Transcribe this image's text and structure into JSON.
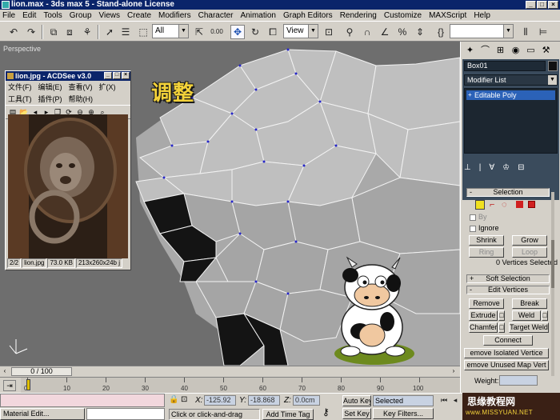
{
  "window": {
    "title": "lion.max - 3ds max 5 - Stand-alone License"
  },
  "menu": [
    "File",
    "Edit",
    "Tools",
    "Group",
    "Views",
    "Create",
    "Modifiers",
    "Character",
    "Animation",
    "Graph Editors",
    "Rendering",
    "Customize",
    "MAXScript",
    "Help"
  ],
  "toolbar": {
    "selection_filter": "All",
    "spinner_value": "0.00",
    "reference_coord": "View"
  },
  "viewport": {
    "label": "Perspective",
    "annotation": "调整"
  },
  "acdsee": {
    "title": "lion.jpg - ACDSee v3.0",
    "menu": [
      "文件(F)",
      "编辑(E)",
      "查看(V)",
      "扩(X)"
    ],
    "menu2": [
      "工具(T)",
      "插件(P)",
      "帮助(H)"
    ],
    "status": [
      "2/2",
      "lion.jpg",
      "73.0 KB",
      "213x260x24b j"
    ]
  },
  "command_panel": {
    "object_name": "Box01",
    "modifier_list": "Modifier List",
    "stack_item": "Editable Poly",
    "selection": {
      "title": "Selection",
      "by": "By",
      "ignore": "Ignore",
      "shrink": "Shrink",
      "grow": "Grow",
      "ring": "Ring",
      "loop": "Loop",
      "status": "0 Vertices Selected"
    },
    "soft_selection": "Soft Selection",
    "edit_vertices": {
      "title": "Edit Vertices",
      "remove": "Remove",
      "break": "Break",
      "extrude": "Extrude",
      "weld": "Weld",
      "chamfer": "Chamfer",
      "target_weld": "Target Weld",
      "connect": "Connect",
      "remove_isolated": "emove Isolated Vertice",
      "remove_unused": "emove Unused Map Vert",
      "weight": "Weight:"
    }
  },
  "timeline": {
    "frame": "0 / 100",
    "ticks": [
      "0",
      "10",
      "20",
      "30",
      "40",
      "50",
      "60",
      "70",
      "80",
      "90",
      "100"
    ]
  },
  "status": {
    "taskbar_item": "Material Edit...",
    "x_label": "X:",
    "x_value": "-125.92",
    "y_label": "Y:",
    "y_value": "-18.868",
    "z_label": "Z:",
    "z_value": "0.0cm",
    "prompt": "Click or click-and-drag",
    "add_time_tag": "Add Time Tag",
    "auto_key": "Auto Key",
    "set_key": "Set Key",
    "selected": "Selected",
    "key_filters": "Key Filters..."
  },
  "watermark": {
    "top": "思缘教程网",
    "bottom": "www.MISSYUAN.NET"
  },
  "colors": {
    "viewport_bg": "#6e6e6e",
    "mesh_light": "#bdbdbd",
    "mesh_dark": "#111111",
    "edge": "#f2f2f2",
    "vertex": "#2525c8",
    "title_bar": "#0a246a",
    "selection_yellow": "#e0c000"
  }
}
